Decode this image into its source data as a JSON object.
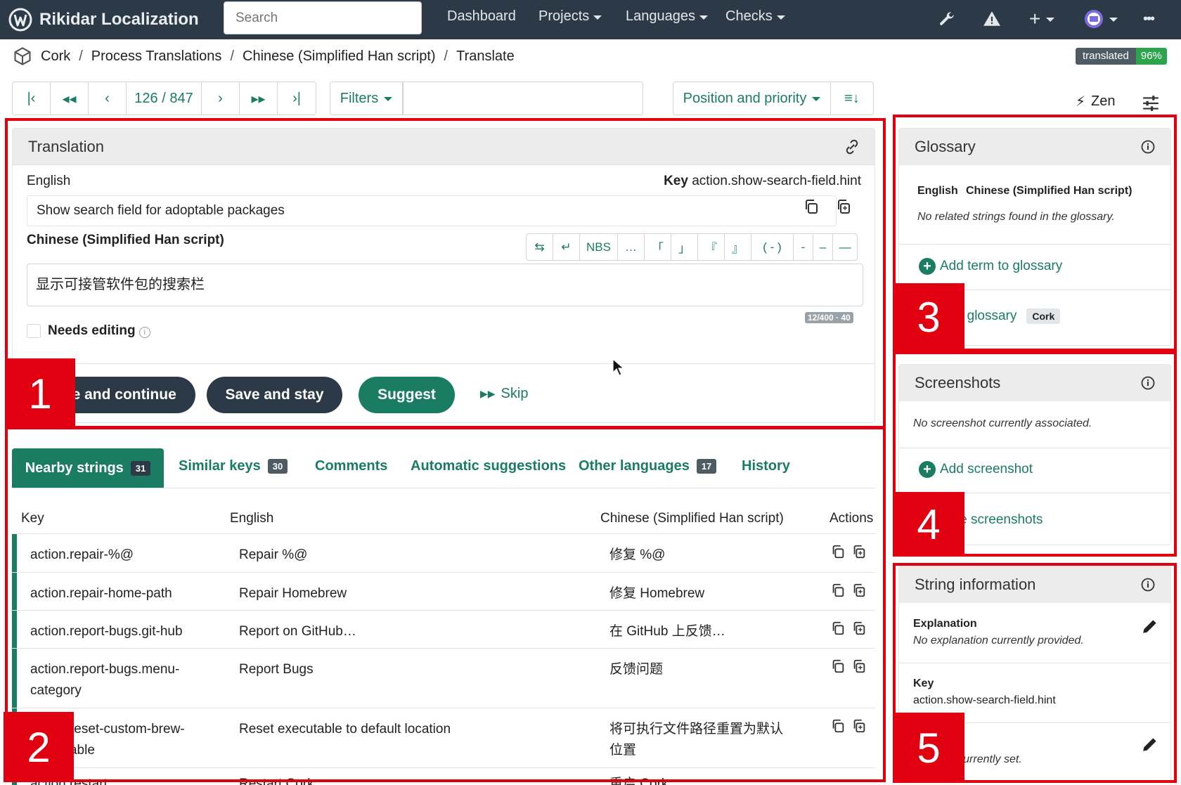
{
  "navbar": {
    "brand": "Rikidar Localization",
    "search_placeholder": "Search",
    "items": [
      {
        "label": "Dashboard",
        "caret": false
      },
      {
        "label": "Projects",
        "caret": true
      },
      {
        "label": "Languages",
        "caret": true
      },
      {
        "label": "Checks",
        "caret": true
      }
    ],
    "more": "•••"
  },
  "breadcrumb": [
    "Cork",
    "Process Translations",
    "Chinese (Simplified Han script)",
    "Translate"
  ],
  "status_badge": {
    "label": "translated",
    "value": "96%"
  },
  "pager": {
    "position": "126 / 847"
  },
  "filters_label": "Filters",
  "sort_label": "Position and priority",
  "zen_label": "Zen",
  "translation": {
    "title": "Translation",
    "source_lang": "English",
    "key_label": "Key",
    "key_value": "action.show-search-field.hint",
    "source_text": "Show search field for adoptable packages",
    "target_lang": "Chinese (Simplified Han script)",
    "target_text": "显示可接管软件包的搜索栏",
    "specials": [
      "⇆",
      "↵",
      "NBS",
      "…",
      "「",
      "」",
      "『",
      "』",
      "( - )",
      "-",
      "–",
      "—"
    ],
    "counter": "12/400 · 40",
    "needs_editing": "Needs editing",
    "save_continue": "Save and continue",
    "save_stay": "Save and stay",
    "suggest": "Suggest",
    "skip": "Skip"
  },
  "tabs": [
    {
      "label": "Nearby strings",
      "count": "31",
      "active": true
    },
    {
      "label": "Similar keys",
      "count": "30"
    },
    {
      "label": "Comments",
      "count": ""
    },
    {
      "label": "Automatic suggestions",
      "count": ""
    },
    {
      "label": "Other languages",
      "count": "17"
    },
    {
      "label": "History",
      "count": ""
    }
  ],
  "table": {
    "headers": [
      "Key",
      "English",
      "Chinese (Simplified Han script)",
      "Actions"
    ],
    "rows": [
      {
        "key": "action.repair-%@",
        "english": "Repair %@",
        "chinese": "修复 %@"
      },
      {
        "key": "action.repair-home-path",
        "english": "Repair Homebrew",
        "chinese": "修复 Homebrew"
      },
      {
        "key": "action.report-bugs.git-hub",
        "english": "Report on GitHub…",
        "chinese": "在 GitHub 上反馈…"
      },
      {
        "key": "action.report-bugs.menu-category",
        "english": "Report Bugs",
        "chinese": "反馈问题"
      },
      {
        "key": "action.reset-custom-brew-executable",
        "english": "Reset executable to default location",
        "chinese": "将可执行文件路径重置为默认位置"
      },
      {
        "key": "action.restart",
        "english": "Restart Cork",
        "chinese": "重启 Cork"
      }
    ]
  },
  "glossary": {
    "title": "Glossary",
    "col_source": "English",
    "col_target": "Chinese (Simplified Han script)",
    "empty": "No related strings found in the glossary.",
    "add": "Add term to glossary",
    "browse": "Browse glossary",
    "project_badge": "Cork"
  },
  "screenshots": {
    "title": "Screenshots",
    "empty": "No screenshot currently associated.",
    "add": "Add screenshot",
    "manage": "Manage screenshots"
  },
  "string_info": {
    "title": "String information",
    "explanation_label": "Explanation",
    "explanation_value": "No explanation currently provided.",
    "key_label": "Key",
    "key_value": "action.show-search-field.hint",
    "flags_value": "No flags currently set."
  },
  "annotations": [
    "1",
    "2",
    "3",
    "4",
    "5"
  ],
  "colors": {
    "accent": "#1a7c63",
    "navbar": "#2c3a48",
    "annotation": "#e00010"
  }
}
